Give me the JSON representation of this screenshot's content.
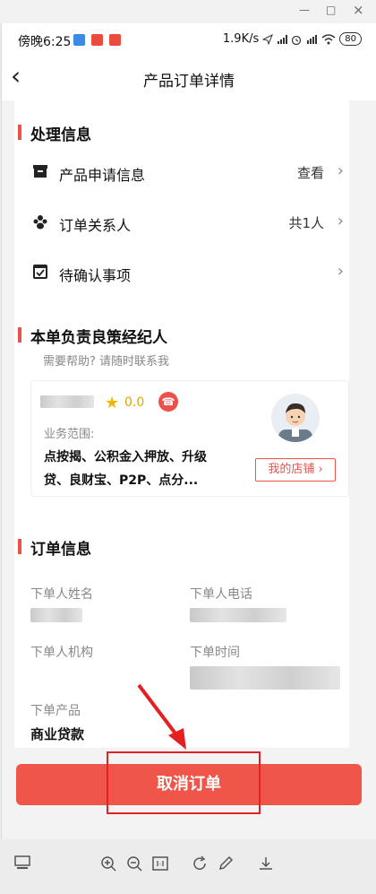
{
  "window": {
    "minimize_glyph": "—",
    "maximize_glyph": "□",
    "close_glyph": "×"
  },
  "status_bar": {
    "time": "傍晚6:25",
    "network_speed": "1.9K/s",
    "battery": "80"
  },
  "nav": {
    "back_glyph": "‹",
    "title": "产品订单详情"
  },
  "processing": {
    "title": "处理信息",
    "rows": [
      {
        "label": "产品申请信息",
        "value": "查看",
        "icon": "folder-icon"
      },
      {
        "label": "订单关系人",
        "value": "共1人",
        "icon": "people-icon"
      },
      {
        "label": "待确认事项",
        "value": "",
        "icon": "checkbox-icon"
      }
    ]
  },
  "agent": {
    "title": "本单负责良策经纪人",
    "hint": "需要帮助? 请随时联系我",
    "rating": "0.0",
    "scope_label": "业务范围:",
    "scope_text": "点按揭、公积金入押放、升级贷、良财宝、P2P、点分...",
    "store_button": "我的店铺"
  },
  "order": {
    "title": "订单信息",
    "fields": {
      "name_label": "下单人姓名",
      "phone_label": "下单人电话",
      "org_label": "下单人机构",
      "time_label": "下单时间",
      "product_label": "下单产品",
      "product_value": "商业贷款"
    }
  },
  "cancel_button": "取消订单",
  "colors": {
    "accent": "#f0504a",
    "highlight": "#e52020"
  }
}
